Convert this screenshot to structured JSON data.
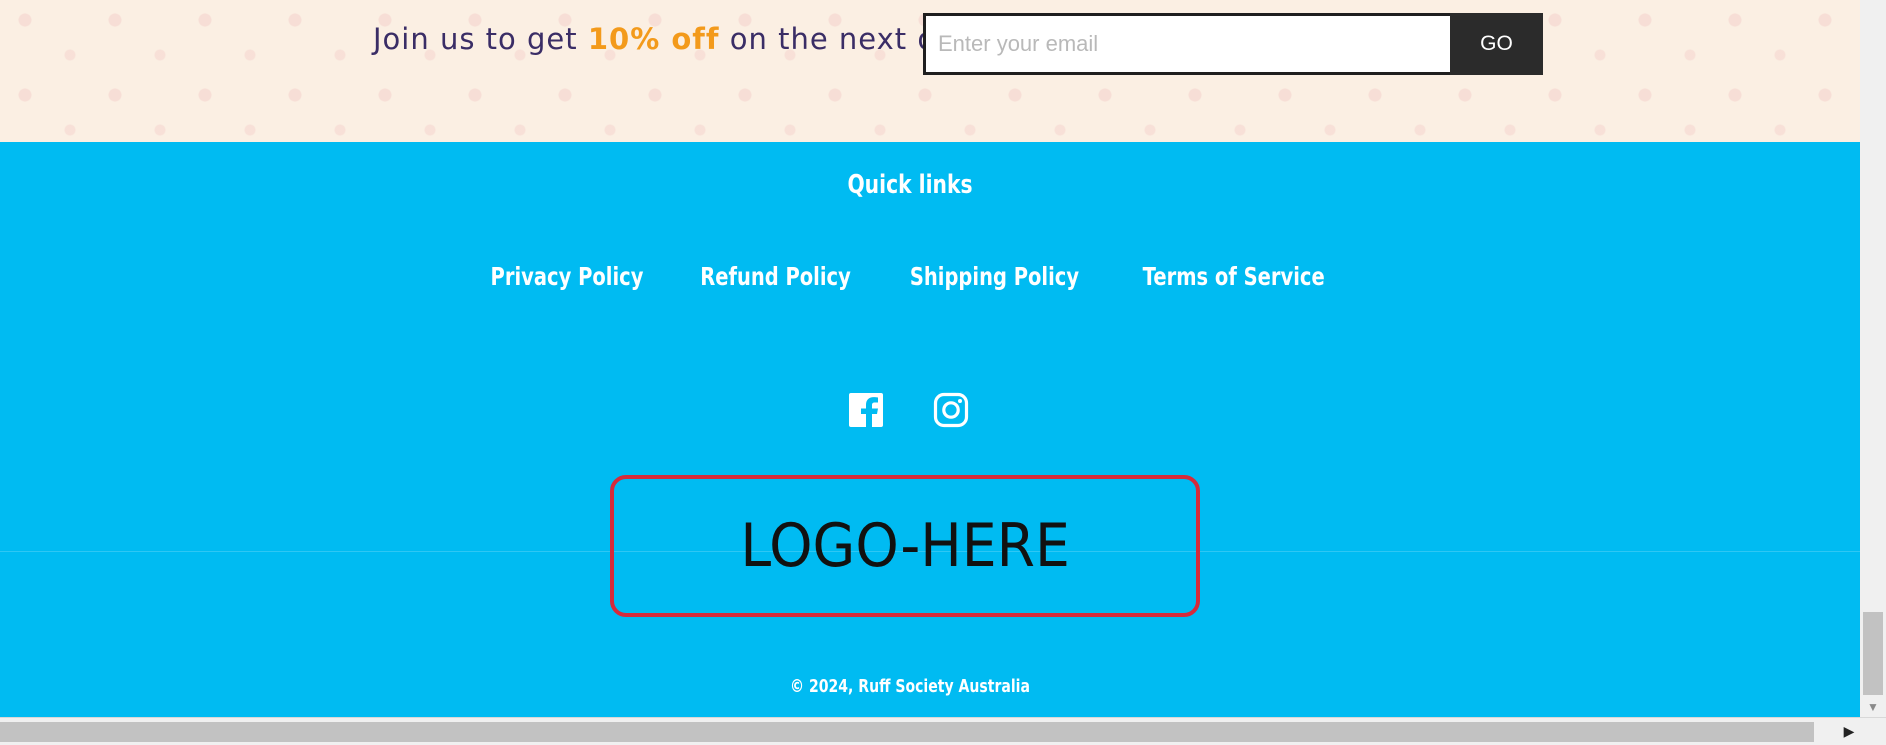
{
  "newsletter": {
    "text_before": "Join us to get",
    "highlight": "10% off",
    "text_after": "on the next order",
    "email_placeholder": "Enter your email",
    "submit_label": "GO",
    "highlight_color": "#f39a1b",
    "text_color": "#3a2d66"
  },
  "footer": {
    "background_color": "#00bbf2",
    "quick_links_heading": "Quick links",
    "links": [
      {
        "label": "Privacy Policy"
      },
      {
        "label": "Refund Policy"
      },
      {
        "label": "Shipping Policy"
      },
      {
        "label": "Terms of Service"
      }
    ],
    "social": [
      {
        "icon": "facebook-icon"
      },
      {
        "icon": "instagram-icon"
      }
    ],
    "logo_text": "LOGO-HERE",
    "logo_border_color": "#d52b3b",
    "copyright": "© 2024, Ruff Society Australia"
  },
  "scrollbars": {
    "vertical_down_arrow": "▼",
    "horizontal_right_arrow": "▶"
  }
}
